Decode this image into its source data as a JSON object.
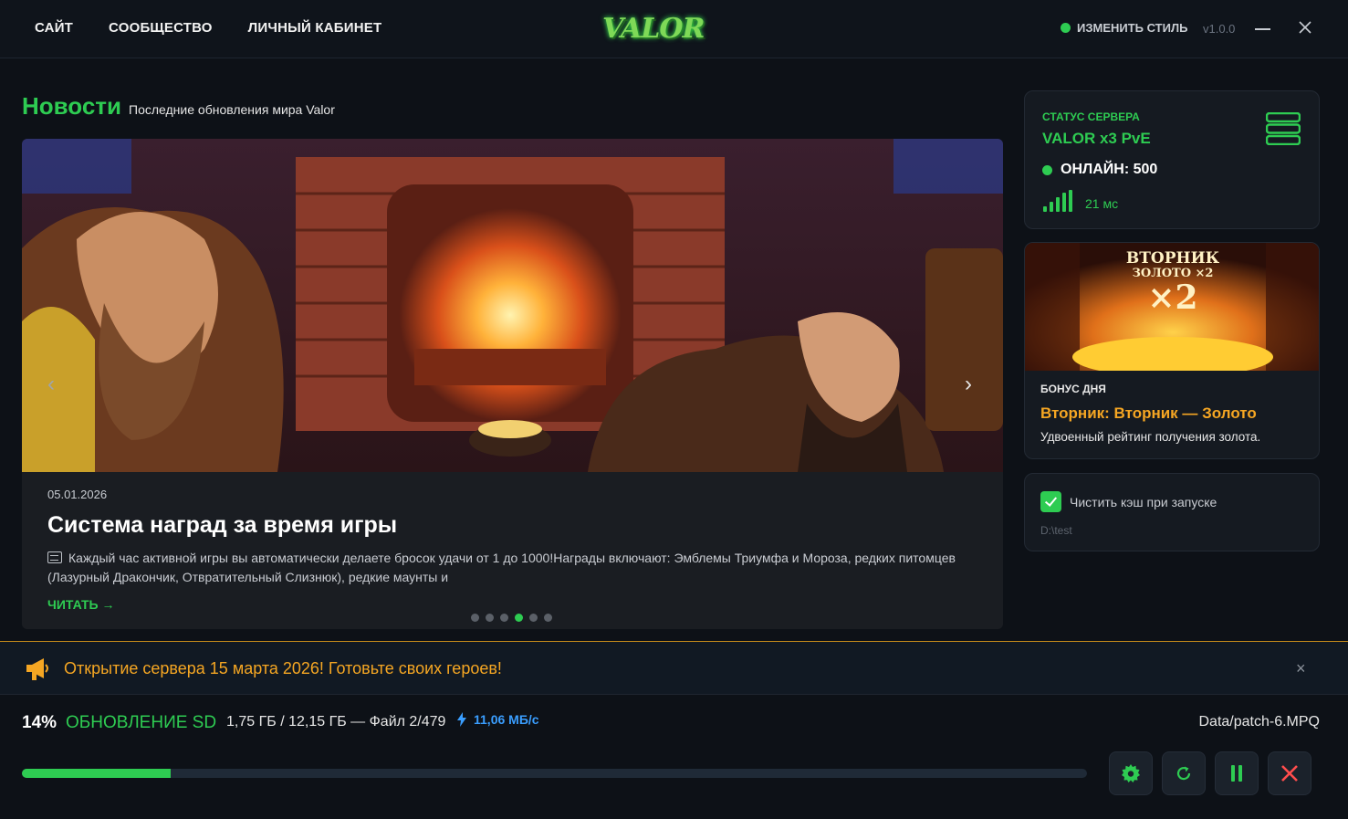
{
  "nav": {
    "site": "САЙТ",
    "community": "СООБЩЕСТВО",
    "account": "ЛИЧНЫЙ КАБИНЕТ"
  },
  "logo": {
    "text": "VALOR"
  },
  "header": {
    "style_label": "ИЗМЕНИТЬ СТИЛЬ",
    "version": "v1.0.0"
  },
  "news": {
    "title": "Новости",
    "subtitle": "Последние обновления мира Valor"
  },
  "slide": {
    "date": "05.01.2026",
    "title": "Система наград за время игры",
    "description": "Каждый час активной игры вы автоматически делаете бросок удачи от 1 до 1000!Награды включают: Эмблемы Триумфа и Мороза, редких питомцев (Лазурный Дракончик, Отвратительный Слизнюк), редкие маунты и",
    "read_more": "ЧИТАТЬ →",
    "prev_arrow": "‹",
    "next_arrow": "›",
    "dots_count": 6,
    "active_dot": 3
  },
  "server": {
    "label": "СТАТУС СЕРВЕРА",
    "name": "VALOR x3 PvE",
    "online": "ОНЛАЙН: 500",
    "ping": "21 мс"
  },
  "bonus": {
    "image_line1": "ВТОРНИК",
    "image_line2": "ЗОЛОТО ×2",
    "image_line3": "×2",
    "label": "БОНУС ДНЯ",
    "title": "Вторник: Вторник — Золото",
    "description": "Удвоенный рейтинг получения золота."
  },
  "cache": {
    "checked": true,
    "label": "Чистить кэш при запуске",
    "path": "D:\\test"
  },
  "announcement": {
    "text": "Открытие сервера 15 марта 2026! Готовьте своих героев!",
    "close": "×"
  },
  "progress": {
    "percent": "14%",
    "percent_value": 14,
    "status": "ОБНОВЛЕНИЕ SD",
    "size": "1,75 ГБ / 12,15 ГБ — Файл 2/479",
    "speed": "11,06 МБ/с",
    "file": "Data/patch-6.MPQ"
  },
  "colors": {
    "accent": "#2ecc52",
    "gold": "#f5a623",
    "speed": "#3a9eff",
    "danger": "#ff4d4d"
  }
}
